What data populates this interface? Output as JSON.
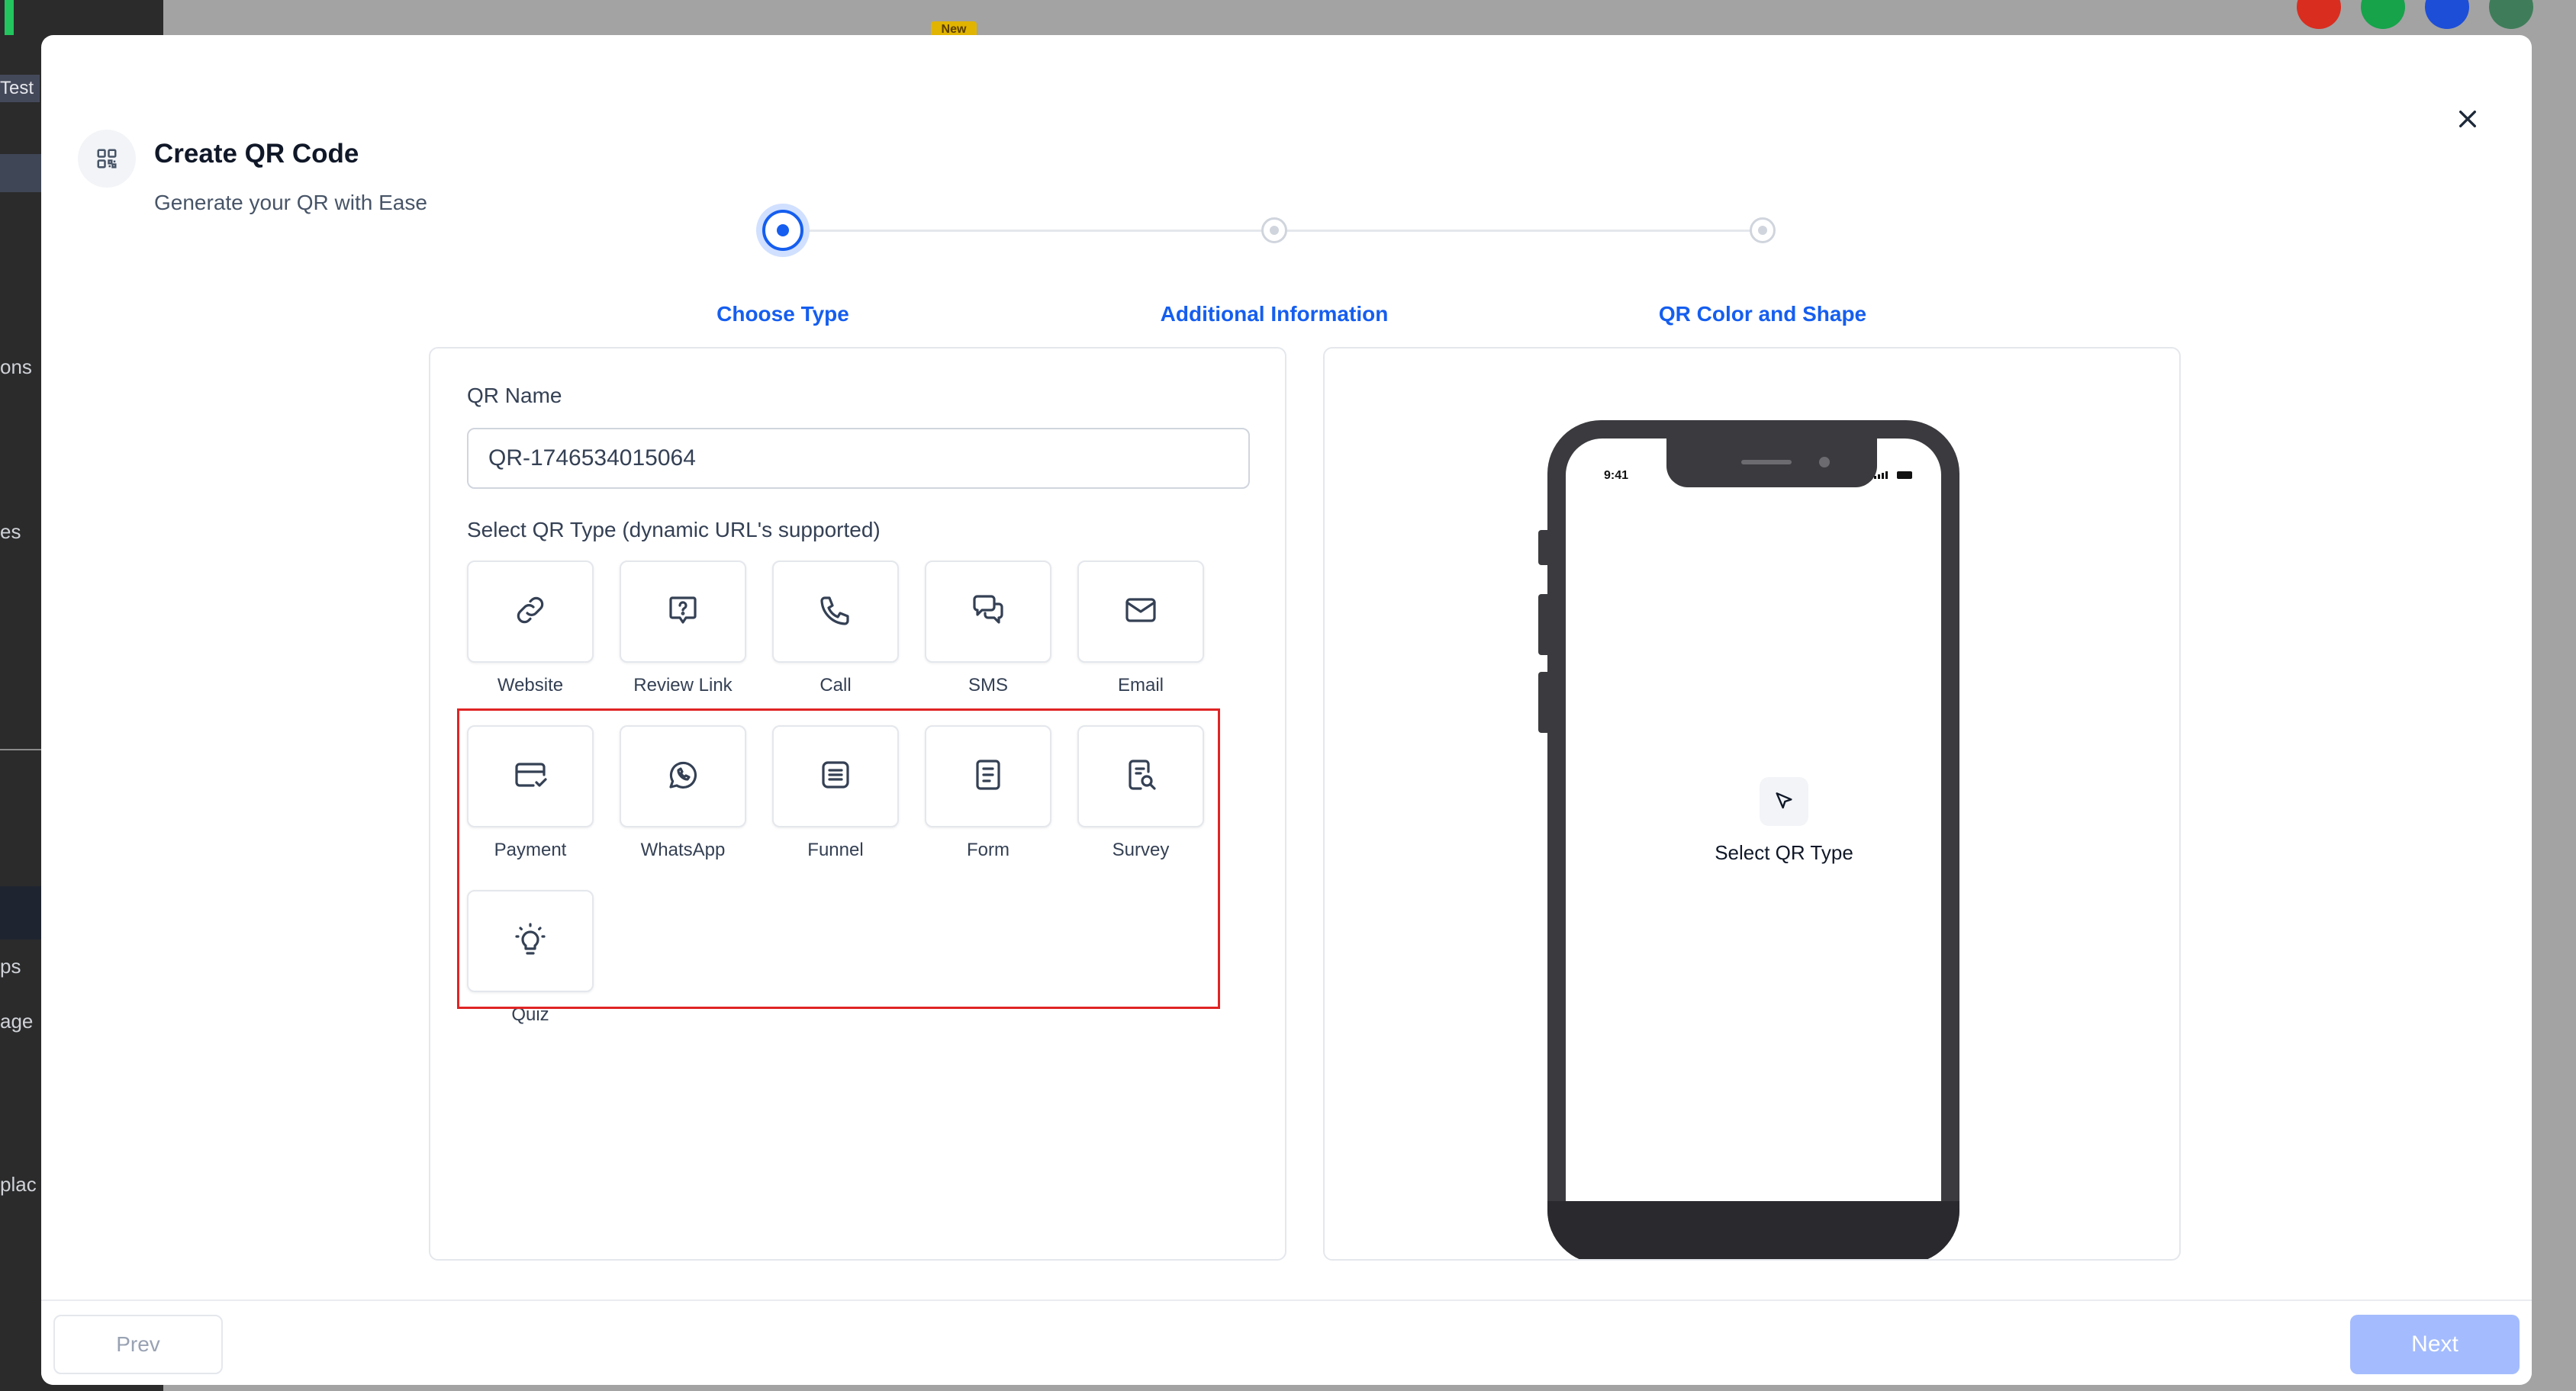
{
  "background": {
    "sidebar_fragments": [
      "Test",
      "ons",
      "es",
      "ps",
      "age",
      "plac"
    ],
    "badge": "New"
  },
  "modal": {
    "title": "Create QR Code",
    "subtitle": "Generate your QR with Ease",
    "header_icon": "qr-code-icon",
    "close_icon": "close-icon"
  },
  "stepper": {
    "steps": [
      {
        "label": "Choose Type",
        "state": "active"
      },
      {
        "label": "Additional Information",
        "state": "pending"
      },
      {
        "label": "QR Color and Shape",
        "state": "pending"
      }
    ],
    "accent": "#155eef"
  },
  "form": {
    "name_label": "QR Name",
    "name_value": "QR-1746534015064",
    "type_label": "Select QR Type (dynamic URL's supported)",
    "types": [
      {
        "label": "Website",
        "icon": "link-icon"
      },
      {
        "label": "Review Link",
        "icon": "message-question-icon"
      },
      {
        "label": "Call",
        "icon": "phone-icon"
      },
      {
        "label": "SMS",
        "icon": "chat-bubbles-icon"
      },
      {
        "label": "Email",
        "icon": "mail-icon"
      },
      {
        "label": "Payment",
        "icon": "credit-card-check-icon"
      },
      {
        "label": "WhatsApp",
        "icon": "whatsapp-icon"
      },
      {
        "label": "Funnel",
        "icon": "funnel-list-icon"
      },
      {
        "label": "Form",
        "icon": "document-icon"
      },
      {
        "label": "Survey",
        "icon": "document-search-icon"
      },
      {
        "label": "Quiz",
        "icon": "lightbulb-icon"
      }
    ]
  },
  "preview": {
    "time": "9:41",
    "placeholder": "Select QR Type",
    "placeholder_icon": "cursor-click-icon"
  },
  "footer": {
    "prev_label": "Prev",
    "next_label": "Next"
  },
  "colors": {
    "highlight_border": "#e02424",
    "next_disabled": "#a4bcfd"
  }
}
